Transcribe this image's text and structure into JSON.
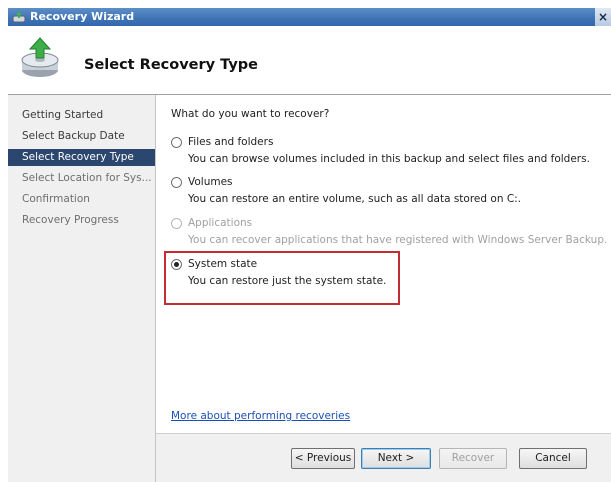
{
  "window": {
    "title": "Recovery Wizard",
    "close_glyph": "×"
  },
  "header": {
    "title": "Select Recovery Type",
    "icon": "recovery-wizard-icon"
  },
  "sidebar": {
    "items": [
      {
        "label": "Getting Started",
        "state": "normal"
      },
      {
        "label": "Select Backup Date",
        "state": "normal"
      },
      {
        "label": "Select Recovery Type",
        "state": "active"
      },
      {
        "label": "Select Location for Sys...",
        "state": "dim"
      },
      {
        "label": "Confirmation",
        "state": "dim"
      },
      {
        "label": "Recovery Progress",
        "state": "dim"
      }
    ]
  },
  "main": {
    "question": "What do you want to recover?",
    "options": [
      {
        "label": "Files and folders",
        "desc": "You can browse volumes included in this backup and select files and folders.",
        "checked": false,
        "enabled": true
      },
      {
        "label": "Volumes",
        "desc": "You can restore an entire volume, such as all data stored on C:.",
        "checked": false,
        "enabled": true
      },
      {
        "label": "Applications",
        "desc": "You can recover applications that have registered with Windows Server Backup.",
        "checked": false,
        "enabled": false
      },
      {
        "label": "System state",
        "desc": "You can restore just the system state.",
        "checked": true,
        "enabled": true
      }
    ],
    "help_link": "More about performing recoveries"
  },
  "footer": {
    "previous": "< Previous",
    "next": "Next >",
    "recover": "Recover",
    "cancel": "Cancel"
  },
  "colors": {
    "titlebar": "#3e72b5",
    "sidebar_active": "#2c476f",
    "highlight_border": "#c42b33",
    "link": "#1a4fb7"
  }
}
